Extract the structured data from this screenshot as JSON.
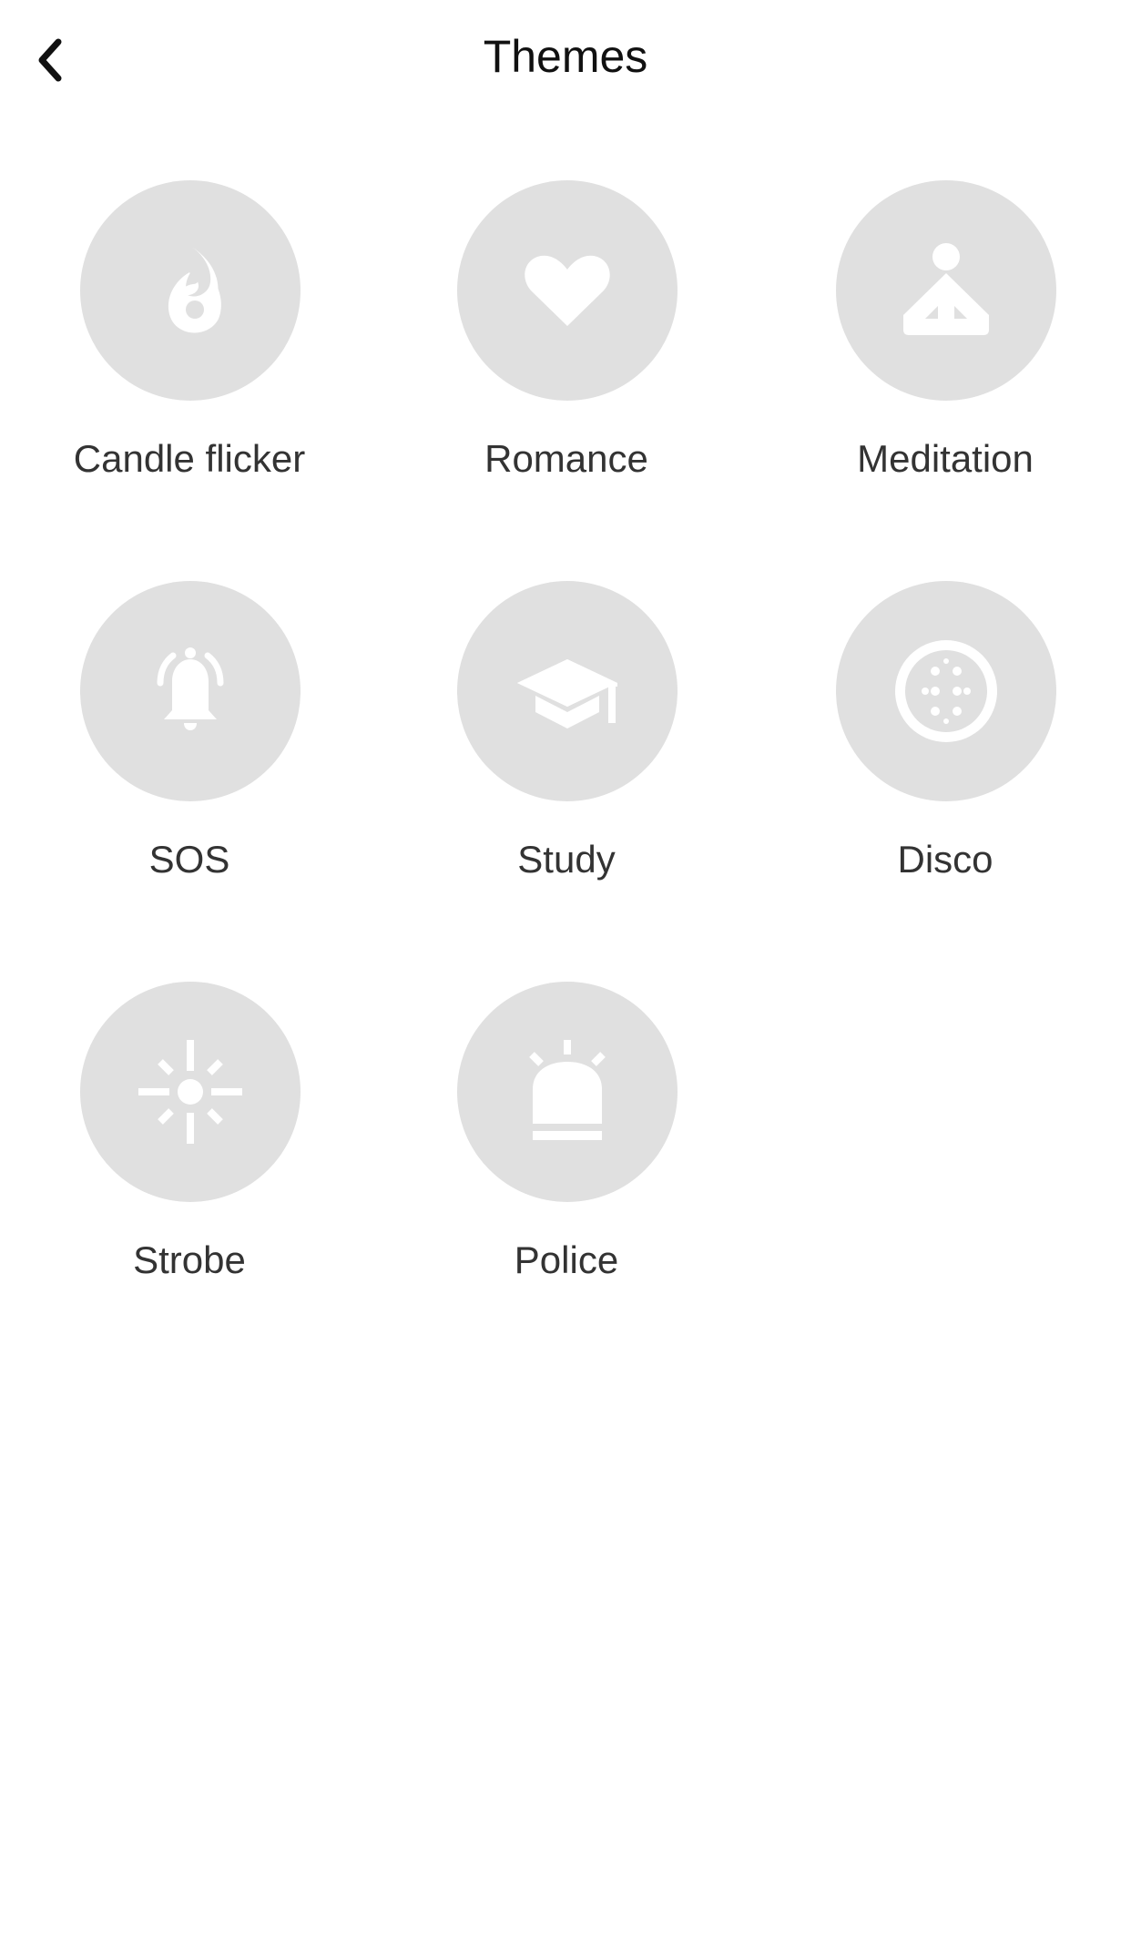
{
  "header": {
    "title": "Themes",
    "back_icon": "chevron-left-icon"
  },
  "colors": {
    "circle_bg": "#e0e0e0",
    "icon_fg": "#ffffff",
    "label_text": "#333333",
    "title_text": "#111111"
  },
  "themes": [
    {
      "label": "Candle flicker",
      "icon": "flame-icon"
    },
    {
      "label": "Romance",
      "icon": "heart-icon"
    },
    {
      "label": "Meditation",
      "icon": "meditation-icon"
    },
    {
      "label": "SOS",
      "icon": "ringing-bell-icon"
    },
    {
      "label": "Study",
      "icon": "graduation-cap-icon"
    },
    {
      "label": "Disco",
      "icon": "disco-ball-icon"
    },
    {
      "label": "Strobe",
      "icon": "strobe-light-icon"
    },
    {
      "label": "Police",
      "icon": "siren-icon"
    }
  ]
}
